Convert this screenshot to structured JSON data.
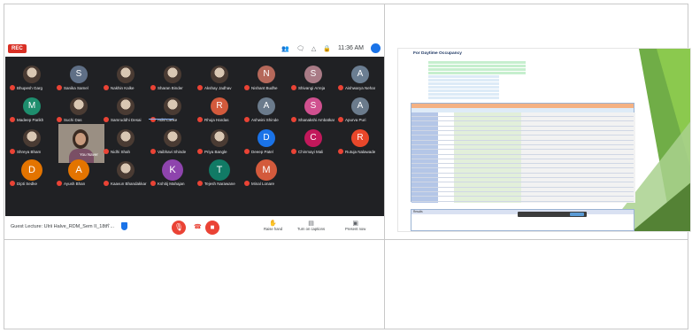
{
  "meet": {
    "rec_label": "REC",
    "clock": "11:36 AM",
    "meeting_title": "Guest Lecture: Ulrii Halve_RDM_Sem II_18th ...",
    "bottom_actions": [
      {
        "label": "Raise hand",
        "icon": "hand-icon"
      },
      {
        "label": "Turn on captions",
        "icon": "captions-icon"
      },
      {
        "label": "Present now",
        "icon": "present-icon"
      }
    ],
    "participants": [
      {
        "name": "Bhupesh Garg",
        "type": "photo"
      },
      {
        "name": "Sanika Samel",
        "type": "letter",
        "letter": "S",
        "color": "#5f6f86"
      },
      {
        "name": "Nakhin Kalke",
        "type": "photo"
      },
      {
        "name": "Sharan Binder",
        "type": "photo"
      },
      {
        "name": "Akshay Jadhav",
        "type": "photo"
      },
      {
        "name": "Nishant Budhe",
        "type": "letter",
        "letter": "N",
        "color": "#b5685a"
      },
      {
        "name": "Shivangi Arreja",
        "type": "letter",
        "letter": "S",
        "color": "#a97b86"
      },
      {
        "name": "Aishwarya Nehar",
        "type": "letter",
        "letter": "A",
        "color": "#6b7e92"
      },
      {
        "name": "Madeep Parikh",
        "type": "letter",
        "letter": "M",
        "color": "#1e8e6e"
      },
      {
        "name": "Suchi Das",
        "type": "photo"
      },
      {
        "name": "Samruddhi Desai",
        "type": "photo"
      },
      {
        "name": "Aditi Lanke",
        "type": "photo"
      },
      {
        "name": "Rhuja Hardas",
        "type": "letter",
        "letter": "R",
        "color": "#d35a3c"
      },
      {
        "name": "Ashwini Shinde",
        "type": "letter",
        "letter": "A",
        "color": "#6b7b8c"
      },
      {
        "name": "Shanakshi Ambatkar",
        "type": "letter",
        "letter": "S",
        "color": "#d0508f"
      },
      {
        "name": "Apurva Puri",
        "type": "letter",
        "letter": "A",
        "color": "#6b7b8c"
      },
      {
        "name": "Shreya Bham",
        "type": "photo"
      },
      {
        "name": "You Naver",
        "type": "video"
      },
      {
        "name": "Nidhi Shah",
        "type": "photo"
      },
      {
        "name": "Vaibhavi Shinde",
        "type": "photo"
      },
      {
        "name": "Priya Bangle",
        "type": "photo"
      },
      {
        "name": "Deeep Patel",
        "type": "letter",
        "letter": "D",
        "color": "#1a73e8"
      },
      {
        "name": "Chinmayi Mali",
        "type": "letter",
        "letter": "C",
        "color": "#c2185b"
      },
      {
        "name": "Rutuja Nalawade",
        "type": "letter",
        "letter": "R",
        "color": "#e8472a"
      },
      {
        "name": "Dipti Sedke",
        "type": "big",
        "letter": "D",
        "color": "#e37400"
      },
      {
        "name": "Ayush Bhan",
        "type": "big",
        "letter": "A",
        "color": "#e37400"
      },
      {
        "name": "Kaavun Bhandakkar",
        "type": "photo"
      },
      {
        "name": "Kshitij Mahajan",
        "type": "big",
        "letter": "K",
        "color": "#8e44ad"
      },
      {
        "name": "Tejesh Narawane",
        "type": "big",
        "letter": "T",
        "color": "#117a65"
      },
      {
        "name": "Minal Lonare",
        "type": "big",
        "letter": "M",
        "color": "#d35a3c"
      }
    ]
  },
  "slide": {
    "title": "For Daytime Occupancy",
    "results_label": "Results"
  },
  "colors": {
    "meet_bg": "#202124",
    "mic_off": "#ea4335",
    "sheet_header": "#f4b183",
    "slide_green": "#70ad47"
  }
}
